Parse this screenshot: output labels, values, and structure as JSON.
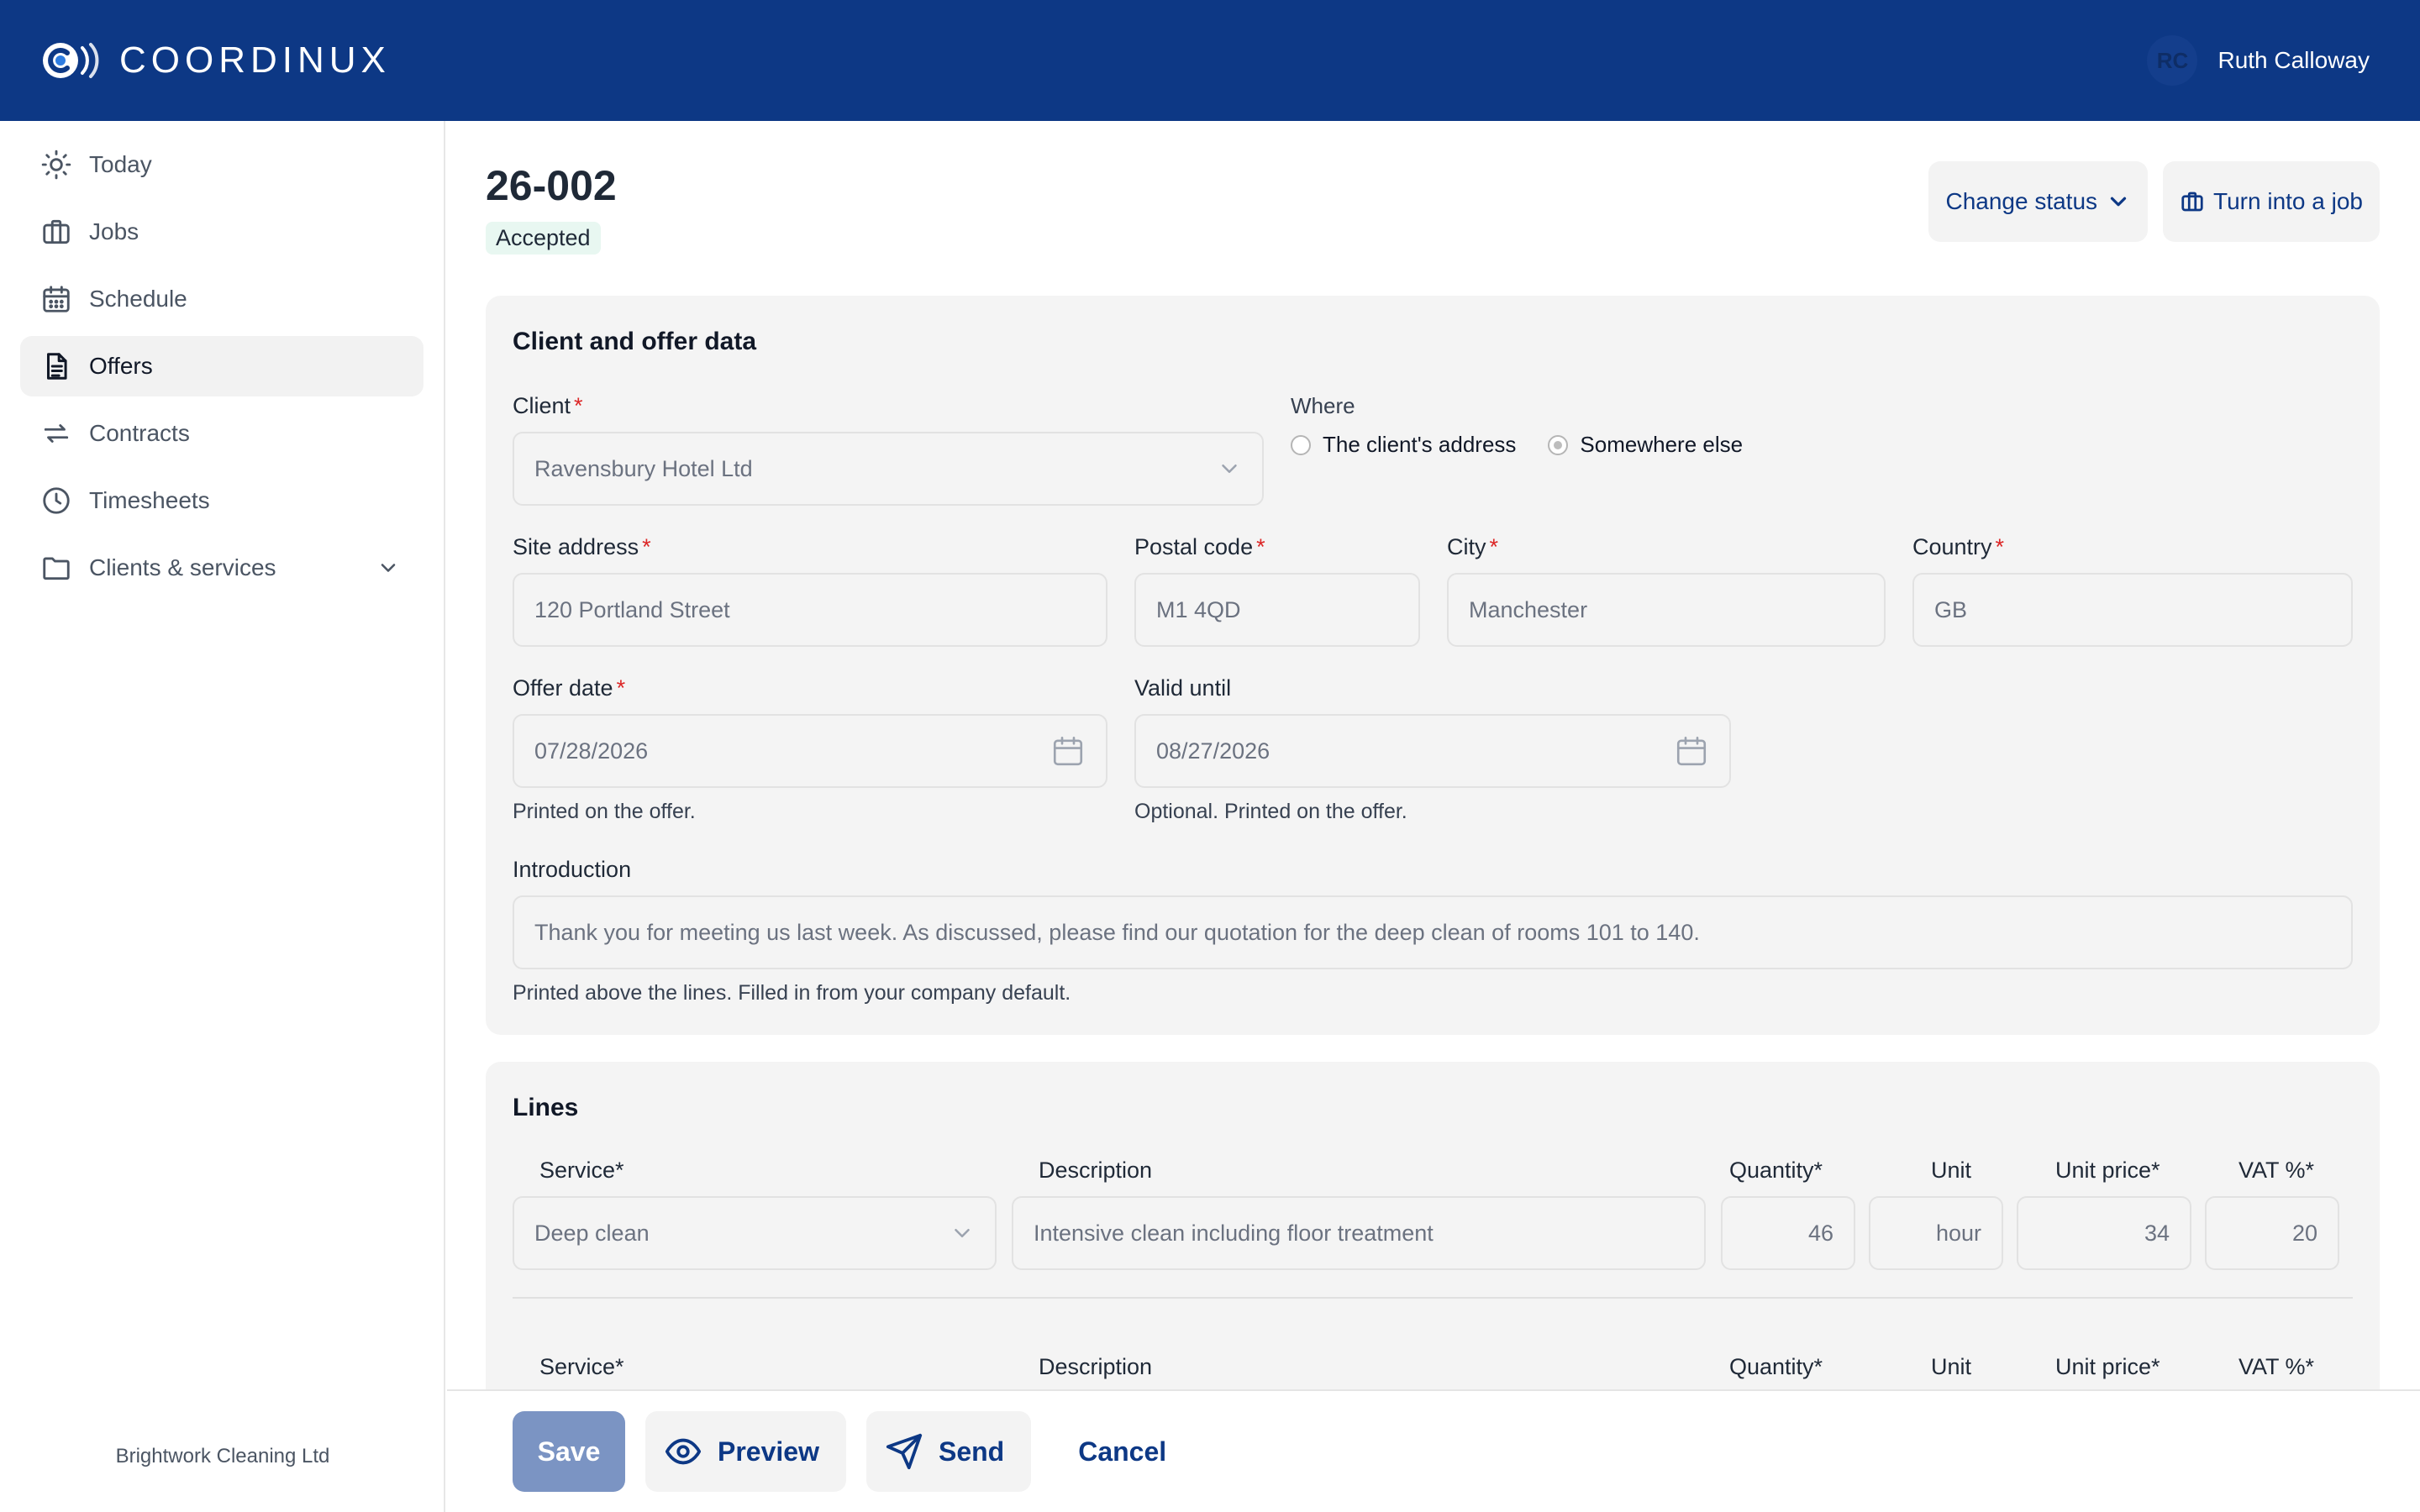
{
  "app": {
    "brand_name": "COORDINUX",
    "user_initials": "RC",
    "user_name": "Ruth Calloway"
  },
  "sidebar": {
    "items": [
      {
        "label": "Today",
        "icon": "sun-icon"
      },
      {
        "label": "Jobs",
        "icon": "briefcase-icon"
      },
      {
        "label": "Schedule",
        "icon": "calendar-icon"
      },
      {
        "label": "Offers",
        "icon": "document-icon",
        "active": true
      },
      {
        "label": "Contracts",
        "icon": "arrows-swap-icon"
      },
      {
        "label": "Timesheets",
        "icon": "clock-icon"
      },
      {
        "label": "Clients & services",
        "icon": "folder-icon",
        "expandable": true
      }
    ],
    "company": "Brightwork Cleaning Ltd"
  },
  "offer": {
    "number": "26-002",
    "status": "Accepted",
    "change_status_label": "Change status",
    "turn_into_job_label": "Turn into a job"
  },
  "client_section": {
    "title": "Client and offer data",
    "client_label": "Client",
    "client_value": "Ravensbury Hotel Ltd",
    "where_label": "Where",
    "where_options": [
      "The client's address",
      "Somewhere else"
    ],
    "where_selected": "Somewhere else",
    "site_address_label": "Site address",
    "site_address_value": "120 Portland Street",
    "postal_code_label": "Postal code",
    "postal_code_value": "M1 4QD",
    "city_label": "City",
    "city_value": "Manchester",
    "country_label": "Country",
    "country_value": "GB",
    "offer_date_label": "Offer date",
    "offer_date_value": "07/28/2026",
    "offer_date_hint": "Printed on the offer.",
    "valid_until_label": "Valid until",
    "valid_until_value": "08/27/2026",
    "valid_until_hint": "Optional. Printed on the offer.",
    "introduction_label": "Introduction",
    "introduction_value": "Thank you for meeting us last week. As discussed, please find our quotation for the deep clean of rooms 101 to 140.",
    "introduction_hint": "Printed above the lines. Filled in from your company default."
  },
  "lines_section": {
    "title": "Lines",
    "columns": {
      "service": "Service*",
      "description": "Description",
      "quantity": "Quantity*",
      "unit": "Unit",
      "unit_price": "Unit price*",
      "vat": "VAT %*"
    },
    "lines": [
      {
        "service": "Deep clean",
        "description": "Intensive clean including floor treatment",
        "quantity": "46",
        "unit": "hour",
        "unit_price": "34",
        "vat": "20"
      }
    ]
  },
  "footer": {
    "save_label": "Save",
    "preview_label": "Preview",
    "send_label": "Send",
    "cancel_label": "Cancel"
  },
  "colors": {
    "brand_blue": "#0d3885",
    "required_red": "#dc2626",
    "save_button": "#7b94c3"
  }
}
